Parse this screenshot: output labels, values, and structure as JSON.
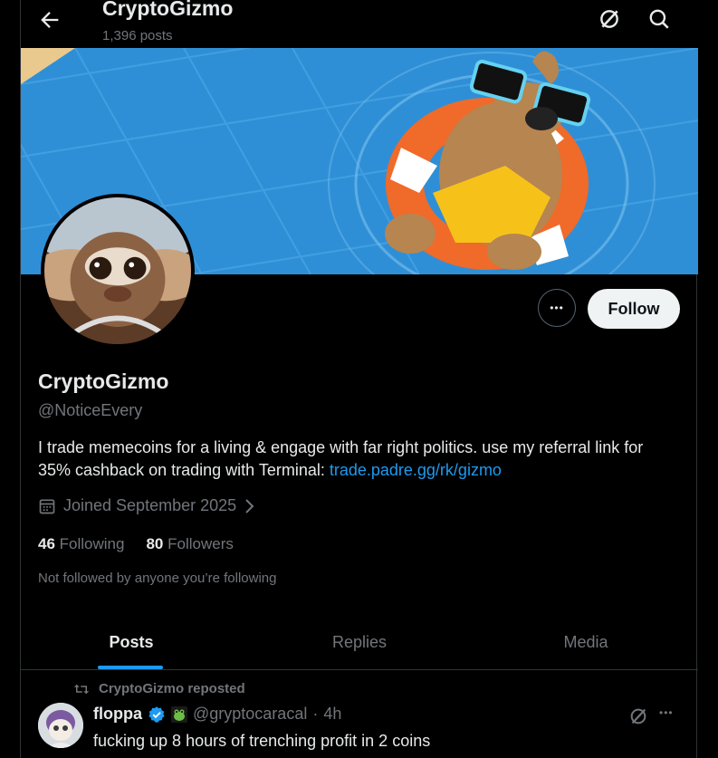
{
  "header": {
    "name": "CryptoGizmo",
    "posts": "1,396 posts"
  },
  "profile": {
    "name": "CryptoGizmo",
    "handle": "@NoticeEvery",
    "bio_text": "I trade memecoins for a living & engage with far right politics. use my referral link for 35% cashback on trading with Terminal: ",
    "bio_link": "trade.padre.gg/rk/gizmo",
    "joined": "Joined September 2025",
    "following_count": "46",
    "following_label": "Following",
    "followers_count": "80",
    "followers_label": "Followers",
    "not_followed": "Not followed by anyone you’re following",
    "follow_label": "Follow",
    "more_label": "•••"
  },
  "tabs": [
    {
      "label": "Posts",
      "active": true
    },
    {
      "label": "Replies",
      "active": false
    },
    {
      "label": "Media",
      "active": false
    }
  ],
  "post": {
    "repost_text": "CryptoGizmo reposted",
    "author": "floppa",
    "handle": "@gryptocaracal",
    "sep": "·",
    "time": "4h",
    "text": "fucking up 8 hours of trenching profit in 2 coins",
    "more_label": "•••"
  },
  "colors": {
    "accent": "#1d9bf0",
    "background": "#000000",
    "muted": "#71767b"
  },
  "icons": [
    "back-arrow-icon",
    "grok-icon",
    "search-icon",
    "more-icon",
    "calendar-icon",
    "chevron-right-icon",
    "repost-icon",
    "verified-badge-icon",
    "frog-emoji-icon"
  ]
}
